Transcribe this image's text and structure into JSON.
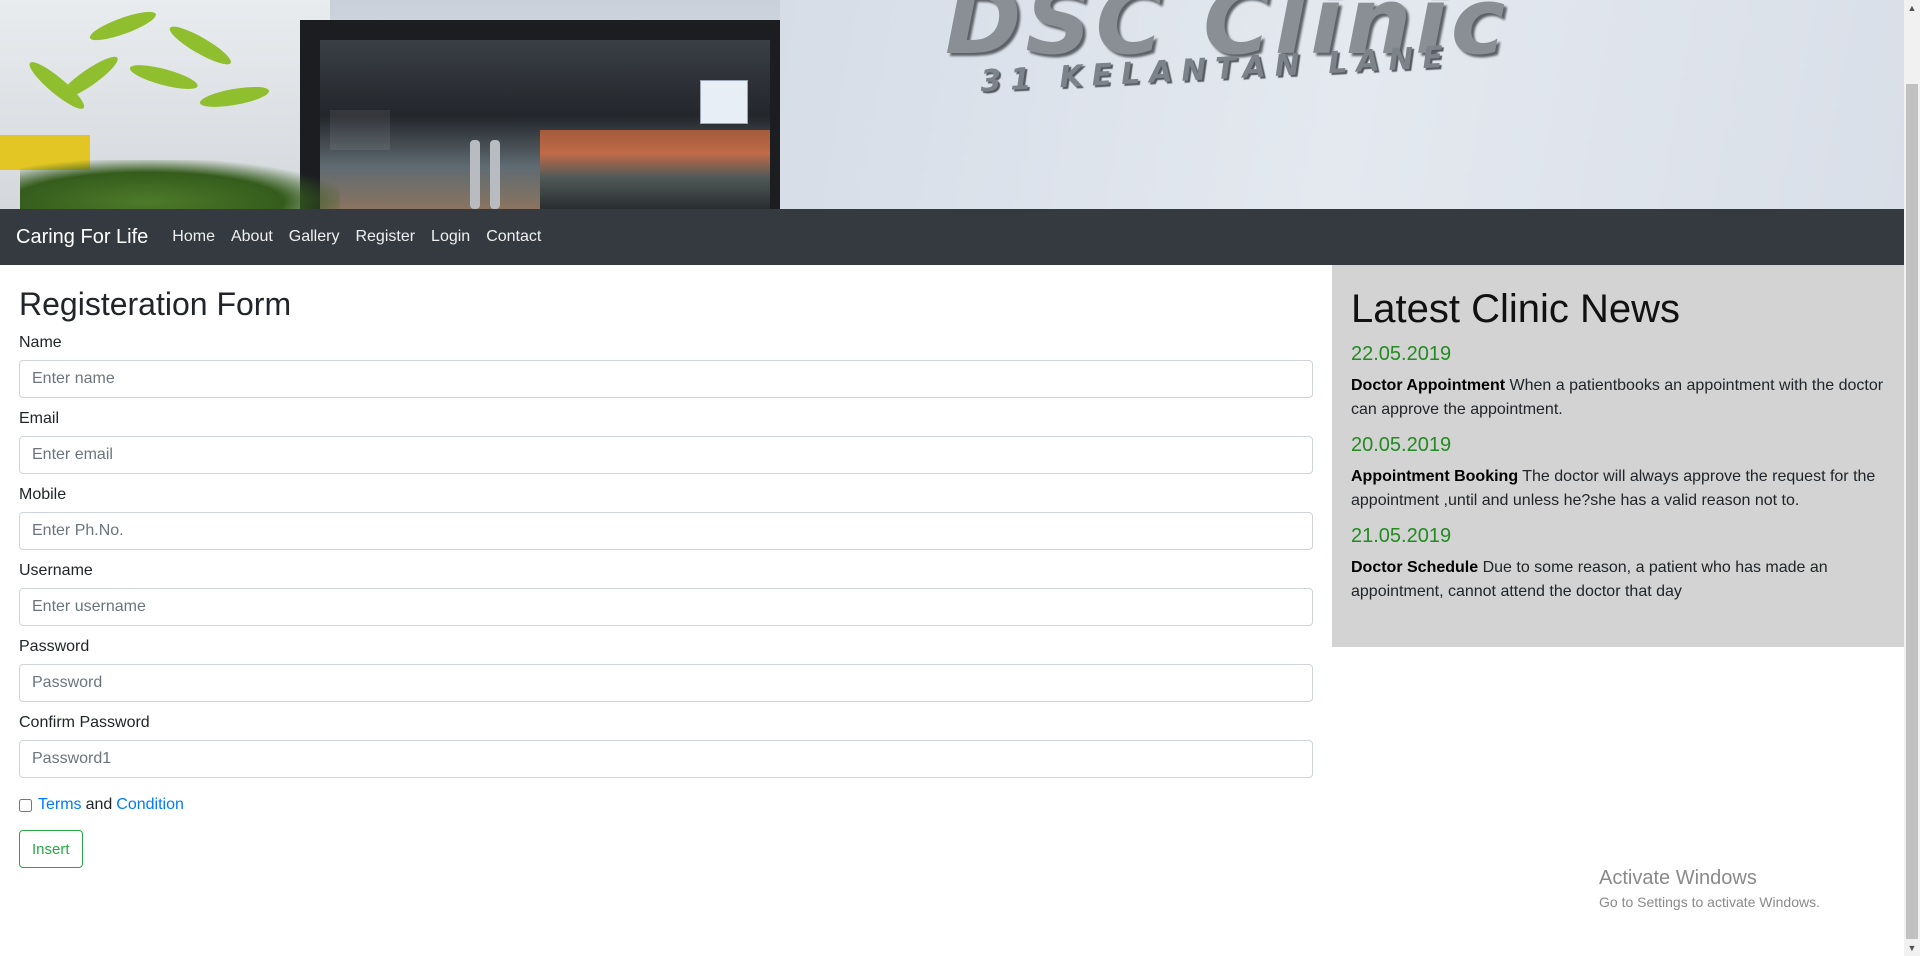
{
  "hero": {
    "sign_text": "DSC Clinic",
    "sign_subtext": "31 KELANTAN LANE"
  },
  "navbar": {
    "brand": "Caring For Life",
    "links": [
      "Home",
      "About",
      "Gallery",
      "Register",
      "Login",
      "Contact"
    ]
  },
  "form": {
    "title": "Registeration Form",
    "fields": [
      {
        "label": "Name",
        "placeholder": "Enter name",
        "value": ""
      },
      {
        "label": "Email",
        "placeholder": "Enter email",
        "value": ""
      },
      {
        "label": "Mobile",
        "placeholder": "Enter Ph.No.",
        "value": ""
      },
      {
        "label": "Username",
        "placeholder": "Enter username",
        "value": ""
      },
      {
        "label": "Password",
        "placeholder": "Password",
        "value": ""
      },
      {
        "label": "Confirm Password",
        "placeholder": "Password1",
        "value": ""
      }
    ],
    "terms": {
      "link1": "Terms",
      "and": "and",
      "link2": "Condition",
      "checked": false
    },
    "submit_label": "Insert"
  },
  "news": {
    "title": "Latest Clinic News",
    "items": [
      {
        "date": "22.05.2019",
        "heading": "Doctor Appointment",
        "text": "When a patientbooks an appointment with the doctor can approve the appointment."
      },
      {
        "date": "20.05.2019",
        "heading": "Appointment Booking",
        "text": "The doctor will always approve the request for the appointment ,until and unless he?she has a valid reason not to."
      },
      {
        "date": "21.05.2019",
        "heading": "Doctor Schedule",
        "text": "Due to some reason, a patient who has made an appointment, cannot attend the doctor that day"
      }
    ]
  },
  "watermark": {
    "title": "Activate Windows",
    "subtitle": "Go to Settings to activate Windows."
  },
  "colors": {
    "navbar_bg": "#343a40",
    "link": "#007bff",
    "success": "#28a745",
    "news_bg": "#d3d3d3",
    "news_date": "#228b22"
  }
}
